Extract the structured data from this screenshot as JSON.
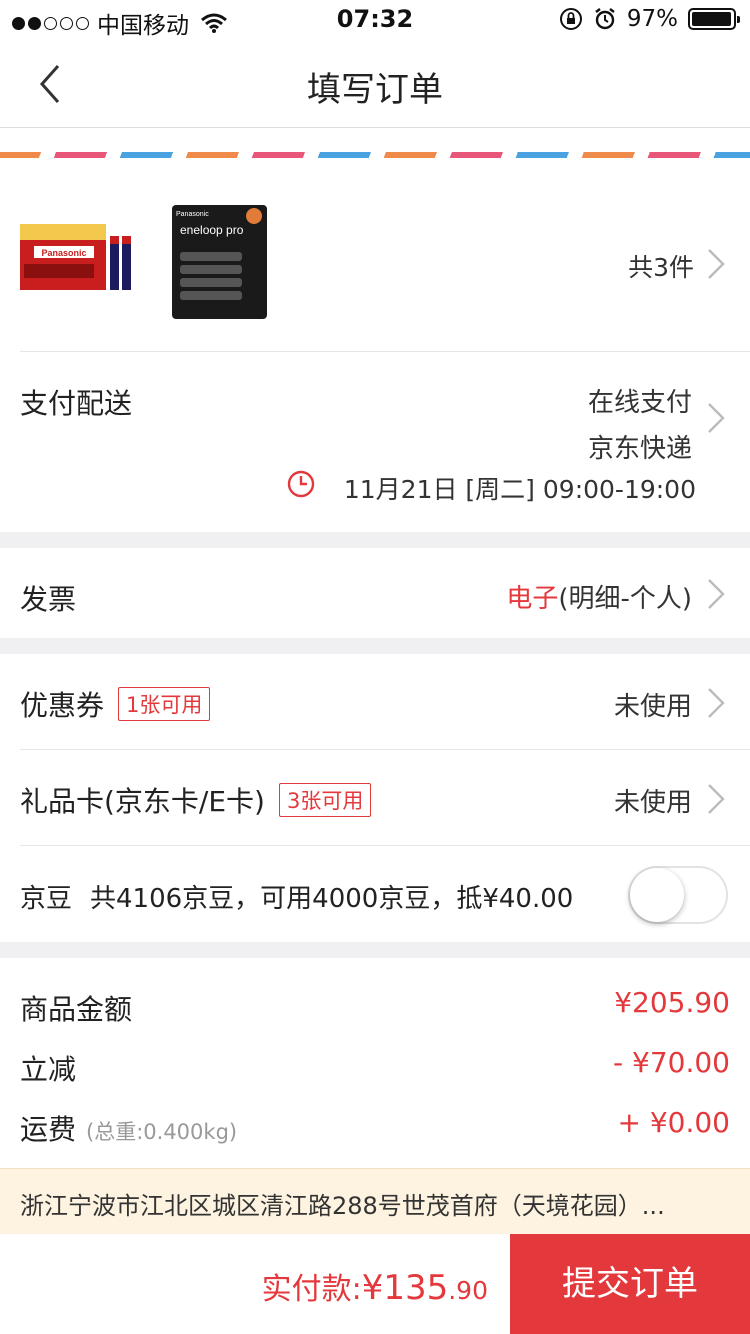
{
  "status_bar": {
    "carrier": "中国移动",
    "time": "07:32",
    "battery": "97%",
    "signal_strength": 2
  },
  "nav": {
    "title": "填写订单"
  },
  "goods": {
    "count_label": "共3件",
    "items": [
      {
        "brand": "Panasonic",
        "name": "松下电器"
      },
      {
        "brand": "Panasonic",
        "name": "eneloop pro"
      }
    ]
  },
  "payment": {
    "label": "支付配送",
    "method": "在线支付",
    "shipping": "京东快递",
    "delivery_time": "11月21日 [周二] 09:00-19:00"
  },
  "invoice": {
    "label": "发票",
    "type": "电子",
    "detail": "(明细-个人)"
  },
  "coupon": {
    "label": "优惠券",
    "tag": "1张可用",
    "value": "未使用"
  },
  "gift_card": {
    "label": "礼品卡(京东卡/E卡)",
    "tag": "3张可用",
    "value": "未使用"
  },
  "jingdou": {
    "label": "京豆",
    "desc": "共4106京豆，可用4000京豆，抵¥40.00",
    "enabled": false
  },
  "amounts": {
    "goods_label": "商品金额",
    "goods_value": "¥205.90",
    "discount_label": "立减",
    "discount_value": "- ¥70.00",
    "shipping_label": "运费",
    "shipping_note": "(总重:0.400kg)",
    "shipping_value": "+ ¥0.00"
  },
  "address": {
    "text": "浙江宁波市江北区城区清江路288号世茂首府（天境花园）..."
  },
  "footer": {
    "total_prefix": "实付款:",
    "total_main": "¥135",
    "total_decimal": ".90",
    "submit_label": "提交订单"
  },
  "colors": {
    "accent": "#e4393c",
    "address_bg": "#fdf3e0"
  }
}
